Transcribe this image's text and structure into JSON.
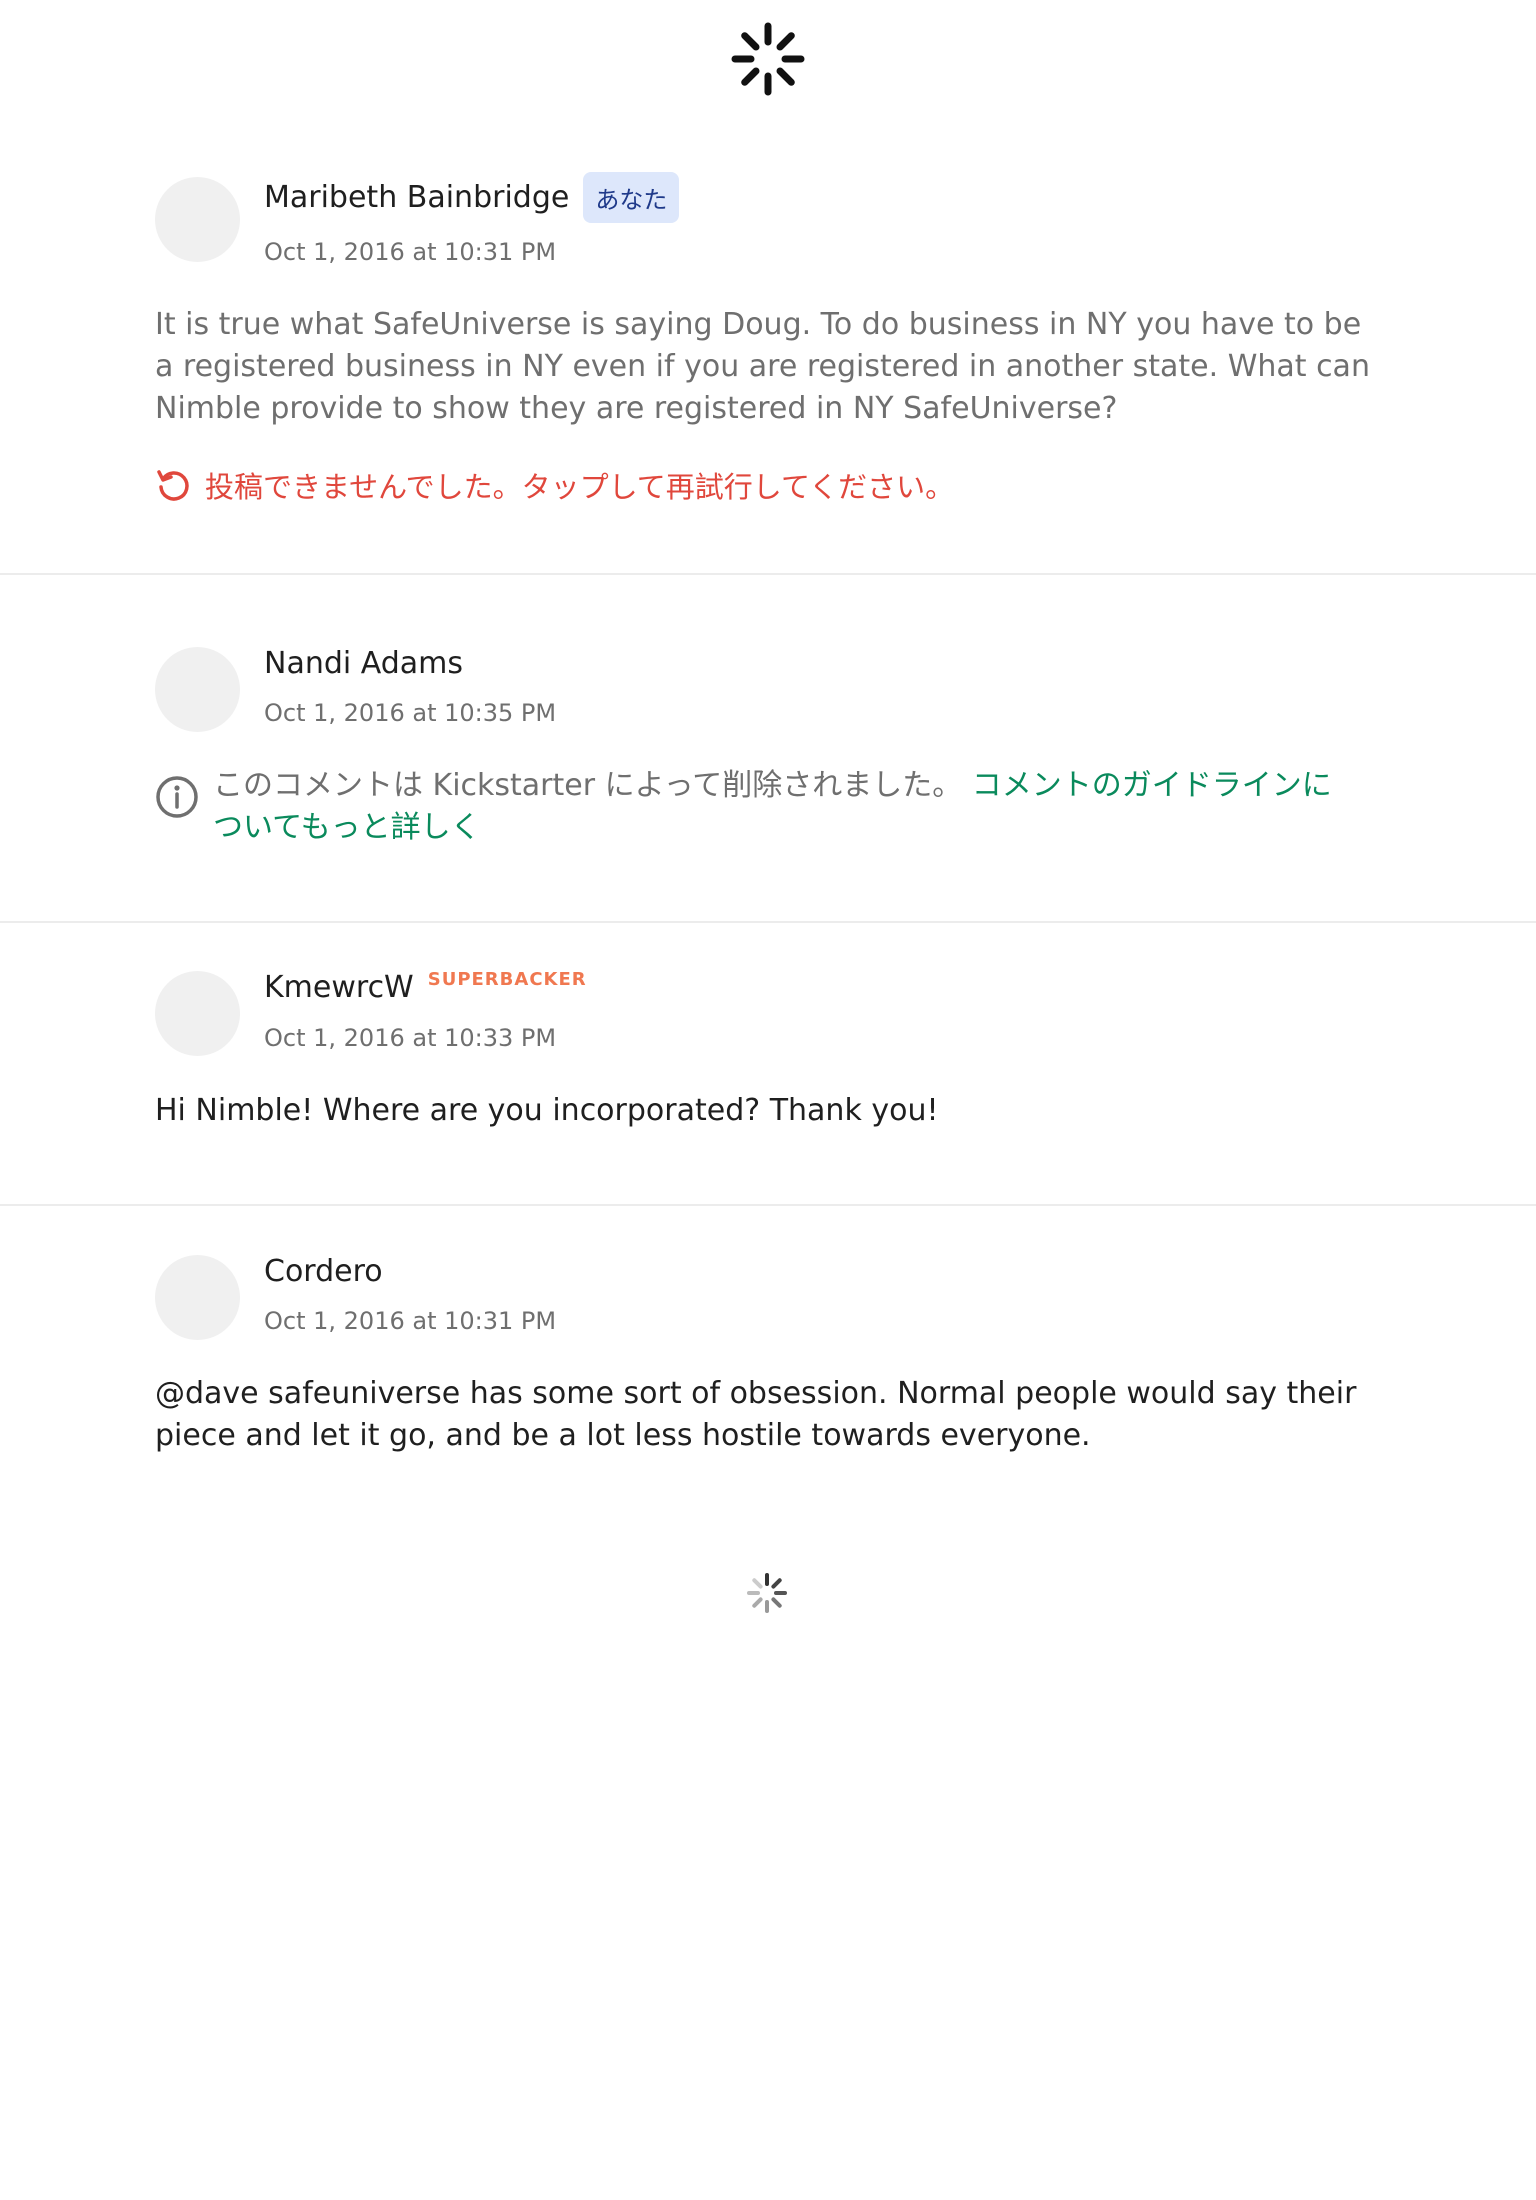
{
  "comments": [
    {
      "author": "Maribeth Bainbridge",
      "badge": "あなた",
      "date": "Oct 1, 2016 at 10:31 PM",
      "body": "It is true what SafeUniverse is saying Doug. To do business in NY you have to be a registered business in NY even if you are registered in another state. What can Nimble provide to show they are registered in NY SafeUniverse?",
      "error": "投稿できませんでした。タップして再試行してください。"
    },
    {
      "author": "Nandi Adams",
      "date": "Oct 1, 2016 at 10:35 PM",
      "removed_notice": "このコメントは Kickstarter によって削除されました。",
      "guidelines_link": "コメントのガイドラインについてもっと詳しく"
    },
    {
      "author": "KmewrcW",
      "badge": "SUPERBACKER",
      "date": "Oct 1, 2016 at 10:33 PM",
      "body": "Hi Nimble! Where are you incorporated? Thank you!"
    },
    {
      "author": "Cordero",
      "date": "Oct 1, 2016 at 10:31 PM",
      "body": "@dave safeuniverse has some sort of obsession. Normal people would say their piece and let it go, and be a lot less hostile towards everyone."
    }
  ],
  "icons": {
    "top": "loading-spinner-icon",
    "error": "retry-icon",
    "removed": "info-icon",
    "bottom": "loading-spinner-icon"
  },
  "colors": {
    "error": "#e0473c",
    "link": "#0a8a5c",
    "superbacker": "#f07850",
    "you_badge_bg": "#dde7fb"
  }
}
